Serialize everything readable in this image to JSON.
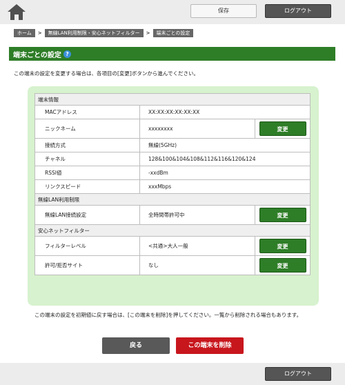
{
  "header": {
    "home_icon": "home-icon",
    "save_label": "保存",
    "logout_label": "ログアウト"
  },
  "breadcrumb": [
    "ホーム",
    "無線LAN利用制限・安心ネットフィルター",
    "端末ごとの設定"
  ],
  "page": {
    "title": "端末ごとの設定",
    "help_icon": "?",
    "description": "この端末の設定を変更する場合は、各項目の[変更]ボタンから進んでください。"
  },
  "sections": {
    "device_info": "端末情報",
    "wlan_limit": "無線LAN利用制限",
    "net_filter": "安心ネットフィルター"
  },
  "rows": {
    "mac": {
      "label": "MACアドレス",
      "value": "XX:XX:XX:XX:XX:XX"
    },
    "nickname": {
      "label": "ニックネーム",
      "value": "xxxxxxxx"
    },
    "connection": {
      "label": "接続方式",
      "value": "無線(5GHz)"
    },
    "channel": {
      "label": "チャネル",
      "value": "128&100&104&108&112&116&120&124"
    },
    "rssi": {
      "label": "RSSI値",
      "value": "-xxdBm"
    },
    "link_speed": {
      "label": "リンクスピード",
      "value": "xxxMbps"
    },
    "wlan_setting": {
      "label": "無線LAN接続設定",
      "value": "全時間帯許可中"
    },
    "filter_level": {
      "label": "フィルターレベル",
      "value": "<共通>大人一般"
    },
    "allow_deny": {
      "label": "許可/拒否サイト",
      "value": "なし"
    }
  },
  "change_label": "変更",
  "note": "この端末の設定を初期値に戻す場合は、[この端末を削除]を押してください。一覧から削除される場合もあります。",
  "footer_buttons": {
    "back": "戻る",
    "delete": "この端末を削除"
  },
  "colors": {
    "accent_green": "#2e7d27",
    "panel_green": "#d7f2ce",
    "delete_red": "#c8161d"
  }
}
